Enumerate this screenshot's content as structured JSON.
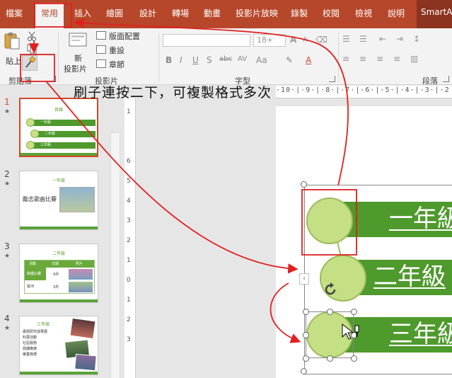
{
  "tabs": [
    {
      "label": "檔案"
    },
    {
      "label": "常用"
    },
    {
      "label": "插入"
    },
    {
      "label": "繪圖"
    },
    {
      "label": "設計"
    },
    {
      "label": "轉場"
    },
    {
      "label": "動畫"
    },
    {
      "label": "投影片放映"
    },
    {
      "label": "錄製"
    },
    {
      "label": "校閱"
    },
    {
      "label": "檢視"
    },
    {
      "label": "說明"
    },
    {
      "label": "SmartArt"
    }
  ],
  "ribbon": {
    "clipboard": {
      "paste_label": "貼上",
      "group_label": "剪貼簿"
    },
    "slides": {
      "new_slide_label": "新",
      "new_slide_label2": "投影片",
      "layout_label": "版面配置",
      "reset_label": "重設",
      "section_label": "章節",
      "group_label": "投影片"
    },
    "font": {
      "size": "18+",
      "group_label": "字型"
    },
    "paragraph": {
      "group_label": "段落"
    }
  },
  "annotation": "刷子連按二下，可複製格式多次",
  "ruler": {
    "h_text": "·10·|·9·|·8·|·7·|·6·|·5·|·4·|·3·|·2",
    "v_numbers": [
      "1",
      "6",
      "5",
      "4",
      "3",
      "2",
      "1",
      "0",
      "1",
      "2",
      "3"
    ]
  },
  "thumbnails": [
    {
      "num": "1",
      "title": "目錄",
      "items": [
        "一年級",
        "二年級",
        "三年級"
      ]
    },
    {
      "num": "2",
      "title": "一年級",
      "caption": "勵志歌曲比賽"
    },
    {
      "num": "3",
      "title": "二年級",
      "table_headers": [
        "活動",
        "日期",
        "照片"
      ],
      "rows": [
        [
          "跳繩比賽",
          "4月"
        ],
        [
          "拔河",
          "3月"
        ]
      ]
    },
    {
      "num": "4",
      "title": "三年級",
      "bullets": [
        "專題研究成果展",
        "科展活動",
        "社區服務",
        "閱讀推廣",
        "畢業典禮"
      ]
    }
  ],
  "smartart": {
    "items": [
      "一年級",
      "二年級",
      "三年級"
    ]
  },
  "colors": {
    "accent": "#b7472a",
    "green": "#4e9a2c",
    "light_green": "#c5df85",
    "red_annotation": "#e02020"
  }
}
